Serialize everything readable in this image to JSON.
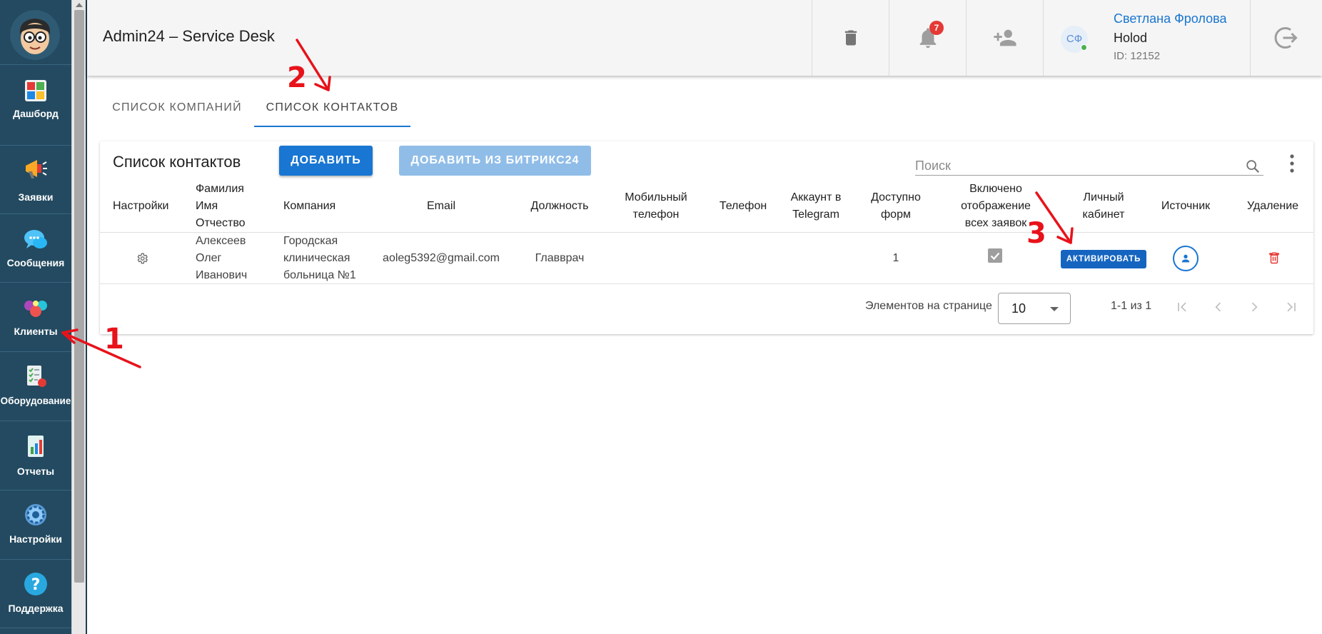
{
  "sidebar": {
    "items": [
      {
        "label": "Дашборд",
        "icon": "dashboard-icon"
      },
      {
        "label": "Заявки",
        "icon": "megaphone-icon"
      },
      {
        "label": "Сообщения",
        "icon": "chat-bubbles-icon"
      },
      {
        "label": "Клиенты",
        "icon": "clients-icon"
      },
      {
        "label": "Оборудование",
        "icon": "equipment-checklist-icon"
      },
      {
        "label": "Отчеты",
        "icon": "report-chart-icon"
      },
      {
        "label": "Настройки",
        "icon": "gear-icon"
      },
      {
        "label": "Поддержка",
        "icon": "help-icon"
      }
    ]
  },
  "header": {
    "title": "Admin24 – Service Desk",
    "notifications_count": "7",
    "user": {
      "initials": "СФ",
      "name": "Светлана Фролова",
      "company": "Holod",
      "id": "ID: 12152"
    }
  },
  "tabs": [
    {
      "label": "СПИСОК КОМПАНИЙ",
      "active": false
    },
    {
      "label": "СПИСОК КОНТАКТОВ",
      "active": true
    }
  ],
  "contacts": {
    "title": "Список контактов",
    "add_label": "ДОБАВИТЬ",
    "add_bitrix_label": "ДОБАВИТЬ ИЗ БИТРИКС24",
    "search_placeholder": "Поиск",
    "columns": {
      "settings": "Настройки",
      "fio": "Фамилия Имя Отчество",
      "company": "Компания",
      "email": "Email",
      "position": "Должность",
      "mobile": "Мобильный телефон",
      "phone": "Телефон",
      "telegram": "Аккаунт в Telegram",
      "forms": "Доступно форм",
      "show_all": "Включено отображение всех заявок",
      "cabinet": "Личный кабинет",
      "source": "Источник",
      "delete": "Удаление"
    },
    "rows": [
      {
        "fio": "Алексеев Олег Иванович",
        "company": "Городская клиническая больница №1",
        "email": "aoleg5392@gmail.com",
        "position": "Главврач",
        "mobile": "",
        "phone": "",
        "telegram": "",
        "forms": "1",
        "show_all": true,
        "activate_label": "АКТИВИРОВАТЬ"
      }
    ],
    "pagination": {
      "per_page_label": "Элементов на странице",
      "per_page_value": "10",
      "range": "1-1 из 1"
    }
  },
  "annotations": [
    "1",
    "2",
    "3"
  ],
  "colors": {
    "sidebar": "#234a60",
    "primary": "#1976d2",
    "annotation": "#e8121a",
    "delete": "#e53935"
  }
}
